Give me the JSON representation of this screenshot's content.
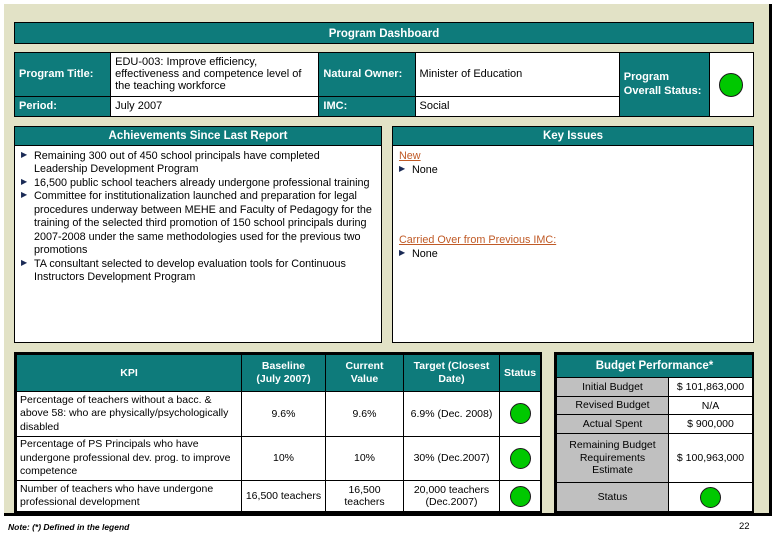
{
  "slide": {
    "title": "Program Dashboard",
    "page_number": "22",
    "note": "Note:  (*) Defined in the legend",
    "accent_color": "#0E7B7B",
    "status_green": "#00C800",
    "canvas_color": "#E2E2C6",
    "issue_label_color": "#C05A26",
    "budget_label_color": "#C0C0C0"
  },
  "header": {
    "program_title_label": "Program Title:",
    "program_title_value": "EDU-003: Improve efficiency, effectiveness and competence level of the teaching workforce",
    "period_label": "Period:",
    "period_value": "July 2007",
    "natural_owner_label": "Natural Owner:",
    "natural_owner_value": "Minister of Education",
    "imc_label": "IMC:",
    "imc_value": "Social",
    "overall_status_label": "Program Overall Status:",
    "overall_status_value": "green"
  },
  "achievements": {
    "heading": "Achievements Since Last Report",
    "items": [
      "Remaining 300 out of 450 school principals have completed Leadership Development  Program",
      "16,500 public school teachers already undergone professional training",
      "Committee for institutionalization launched and preparation for legal procedures underway between MEHE and Faculty of Pedagogy for the training of the selected third promotion of 150 school principals during 2007-2008 under the same methodologies used for the previous two promotions",
      "TA consultant selected to develop evaluation tools for Continuous Instructors Development Program"
    ]
  },
  "key_issues": {
    "heading": "Key Issues",
    "new_label": "New",
    "new_items": [
      "None"
    ],
    "carried_label": "Carried Over from Previous IMC:",
    "carried_items": [
      "None"
    ]
  },
  "kpi": {
    "columns": [
      "KPI",
      "Baseline (July 2007)",
      "Current Value",
      "Target (Closest Date)",
      "Status"
    ],
    "columns_lines": [
      [
        "KPI"
      ],
      [
        "Baseline",
        "(July 2007)"
      ],
      [
        "Current",
        "Value"
      ],
      [
        "Target (Closest",
        "Date)"
      ],
      [
        "Status"
      ]
    ],
    "rows": [
      {
        "name": "Percentage of teachers without a bacc. & above 58: who are physically/psychologically disabled",
        "baseline": "9.6%",
        "current": "9.6%",
        "target": "6.9% (Dec. 2008)",
        "status": "green"
      },
      {
        "name": "Percentage of PS Principals who have undergone professional dev. prog. to improve competence",
        "baseline": "10%",
        "current": "10%",
        "target": "30% (Dec.2007)",
        "status": "green"
      },
      {
        "name": "Number of teachers who have undergone professional development",
        "baseline": "16,500 teachers",
        "current": "16,500 teachers",
        "target": "20,000 teachers (Dec.2007)",
        "status": "green"
      }
    ]
  },
  "budget": {
    "heading": "Budget Performance*",
    "rows": [
      {
        "label": "Initial Budget",
        "value": "$ 101,863,000"
      },
      {
        "label": "Revised Budget",
        "value": "N/A"
      },
      {
        "label": "Actual Spent",
        "value": "$ 900,000"
      },
      {
        "label": "Remaining Budget Requirements Estimate",
        "value": "$ 100,963,000"
      }
    ],
    "status_label": "Status",
    "status_value": "green"
  }
}
